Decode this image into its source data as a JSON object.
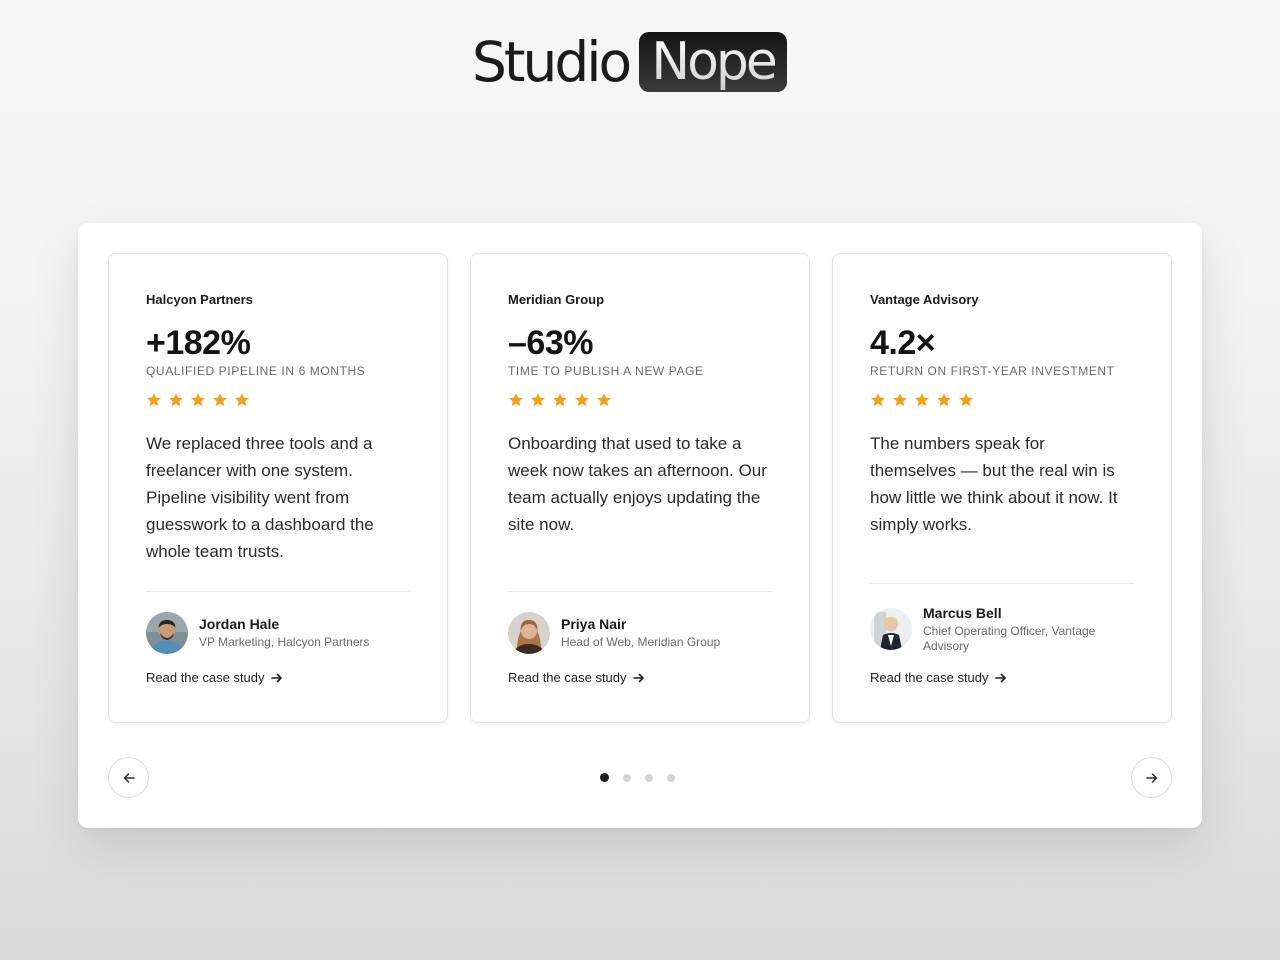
{
  "brand": {
    "word1": "Studio",
    "word2": "Nope"
  },
  "colors": {
    "star": "#f0a316",
    "active_dot": "#1c1c1c",
    "inactive_dot": "#d4d4d4"
  },
  "testimonials": [
    {
      "company": "Halcyon Partners",
      "metric": "+182%",
      "metric_label": "QUALIFIED PIPELINE IN 6 MONTHS",
      "rating": 5,
      "quote": "We replaced three tools and a freelancer with one system. Pipeline visibility went from guesswork to a dashboard the whole team trusts.",
      "name": "Jordan Hale",
      "role": "VP Marketing, Halcyon Partners",
      "link": "Read the case study",
      "avatar_icon": "person-avatar-icon"
    },
    {
      "company": "Meridian Group",
      "metric": "–63%",
      "metric_label": "TIME TO PUBLISH A NEW PAGE",
      "rating": 5,
      "quote": "Onboarding that used to take a week now takes an afternoon. Our team actually enjoys updating the site now.",
      "name": "Priya Nair",
      "role": "Head of Web, Meridian Group",
      "link": "Read the case study",
      "avatar_icon": "person-avatar-icon"
    },
    {
      "company": "Vantage Advisory",
      "metric": "4.2×",
      "metric_label": "RETURN ON FIRST-YEAR INVESTMENT",
      "rating": 5,
      "quote": "The numbers speak for themselves — but the real win is how little we think about it now. It simply works.",
      "name": "Marcus Bell",
      "role": "Chief Operating Officer, Vantage Advisory",
      "link": "Read the case study",
      "avatar_icon": "person-avatar-icon"
    }
  ],
  "carousel": {
    "prev_icon": "arrow-left-icon",
    "next_icon": "arrow-right-icon",
    "total_pages": 4,
    "active_page": 1
  }
}
